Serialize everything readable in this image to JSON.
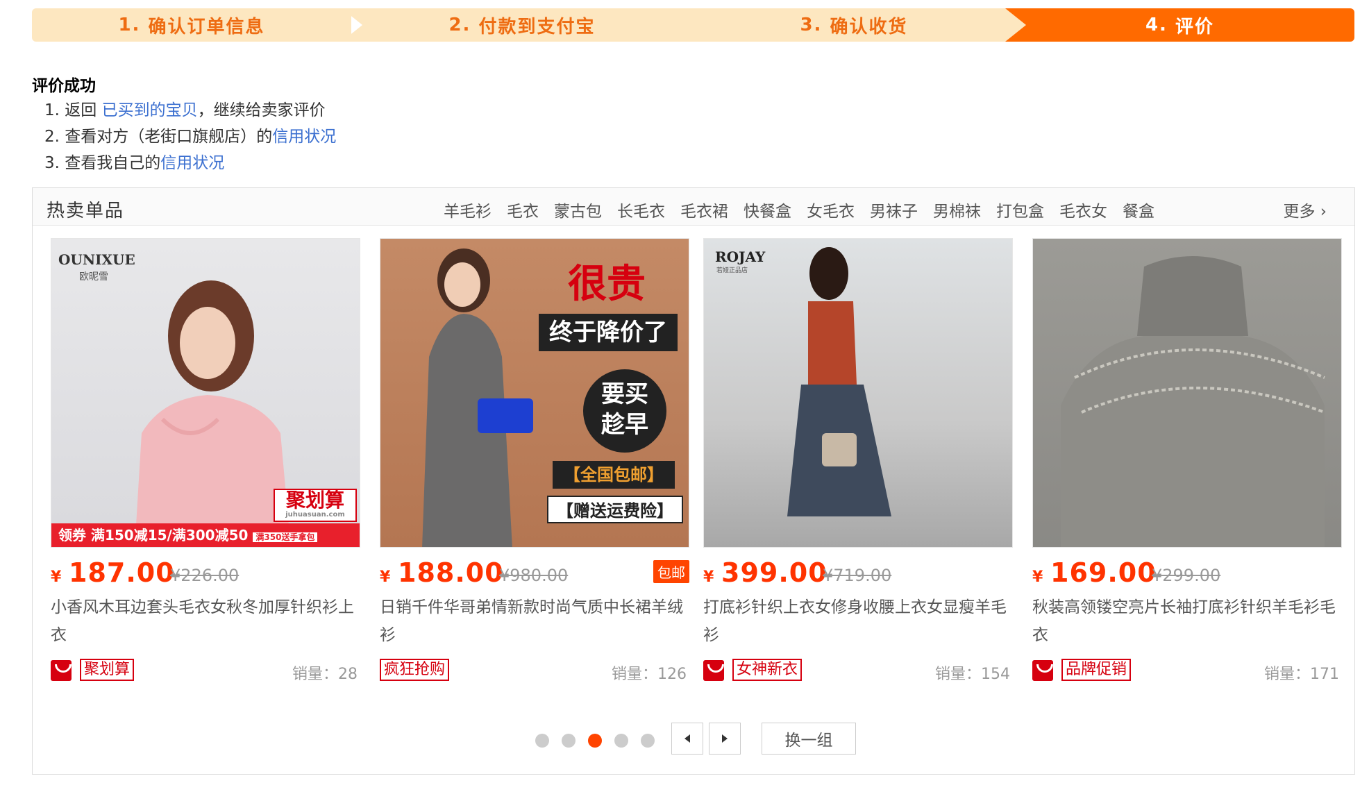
{
  "steps": [
    {
      "num": "1.",
      "label": "确认订单信息"
    },
    {
      "num": "2.",
      "label": "付款到支付宝"
    },
    {
      "num": "3.",
      "label": "确认收货"
    },
    {
      "num": "4.",
      "label": "评价"
    }
  ],
  "success": {
    "title": "评价成功",
    "items": [
      {
        "num": "1.",
        "prefix": "返回 ",
        "link": "已买到的宝贝",
        "suffix": "，继续给卖家评价"
      },
      {
        "num": "2.",
        "prefix": "查看对方（老街口旗舰店）的",
        "link": "信用状况",
        "suffix": ""
      },
      {
        "num": "3.",
        "prefix": "查看我自己的",
        "link": "信用状况",
        "suffix": ""
      }
    ]
  },
  "hot": {
    "title": "热卖单品",
    "tags": [
      "羊毛衫",
      "毛衣",
      "蒙古包",
      "长毛衣",
      "毛衣裙",
      "快餐盒",
      "女毛衣",
      "男袜子",
      "男棉袜",
      "打包盒",
      "毛衣女",
      "餐盒"
    ],
    "more": "更多",
    "items": [
      {
        "yen": "¥",
        "price": "187.00",
        "orig": "¥226.00",
        "baoyou": "",
        "title": "小香风木耳边套头毛衣女秋冬加厚针织衫上衣",
        "promo": "聚划算",
        "sales": "销量：28",
        "img_text": {
          "brand": "OUNIXUE",
          "brand_sub": "欧昵雪",
          "badge": "聚划算",
          "badge_sub": "juhuasuan.com",
          "coupon": "领券 满150减15/满300减50",
          "coupon_sub": "满350送手拿包"
        }
      },
      {
        "yen": "¥",
        "price": "188.00",
        "orig": "¥980.00",
        "baoyou": "包邮",
        "title": "日销千件华哥弟情新款时尚气质中长裙羊绒衫",
        "promo": "疯狂抢购",
        "sales": "销量：126",
        "img_text": {
          "l1": "很贵",
          "l2": "终于降价了",
          "l3": "要买",
          "l4": "趁早",
          "l5": "【全国包邮】",
          "l6": "【赠送运费险】"
        }
      },
      {
        "yen": "¥",
        "price": "399.00",
        "orig": "¥719.00",
        "baoyou": "",
        "title": "打底衫针织上衣女修身收腰上衣女显瘦羊毛衫",
        "promo": "女神新衣",
        "sales": "销量：154",
        "img_text": {
          "brand": "ROJAY",
          "brand_sub": "若娅正品店"
        }
      },
      {
        "yen": "¥",
        "price": "169.00",
        "orig": "¥299.00",
        "baoyou": "",
        "title": "秋装高领镂空亮片长袖打底衫针织羊毛衫毛衣",
        "promo": "品牌促销",
        "sales": "销量：171",
        "img_text": {}
      }
    ],
    "pager": {
      "dots": 5,
      "active": 3,
      "swap": "换一组"
    }
  },
  "colors": {
    "accent": "#ff6a00",
    "step_bg": "#fde7c0",
    "link": "#3c70d0",
    "price": "#ff3300",
    "promo": "#d6000f"
  }
}
